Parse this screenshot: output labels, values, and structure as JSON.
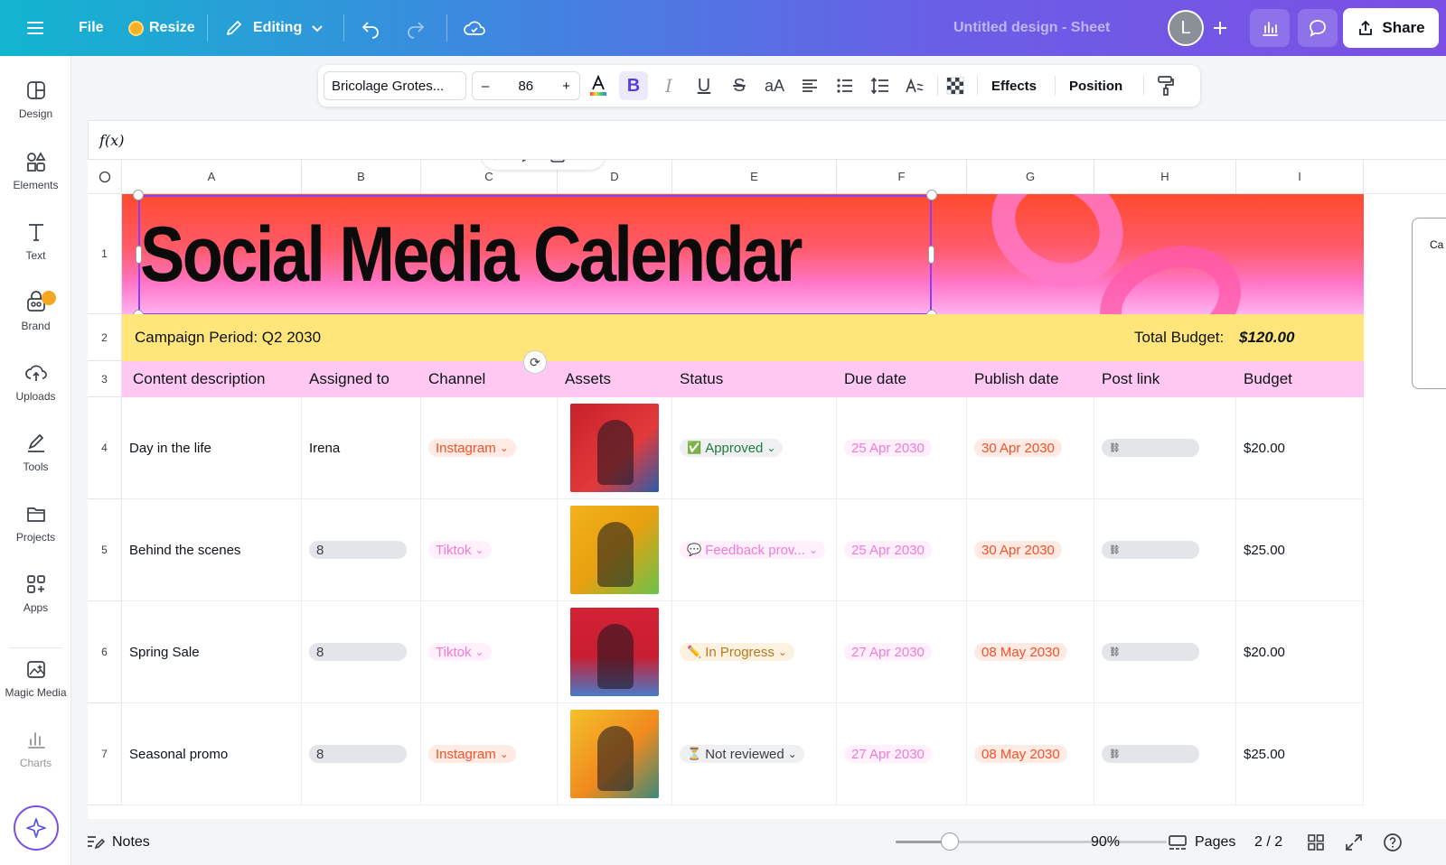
{
  "topbar": {
    "file": "File",
    "resize": "Resize",
    "editing": "Editing",
    "title": "Untitled design - Sheet",
    "avatar_initial": "L",
    "share": "Share"
  },
  "rail": {
    "items": [
      "Design",
      "Elements",
      "Text",
      "Brand",
      "Uploads",
      "Tools",
      "Projects",
      "Apps",
      "Magic Media",
      "Charts"
    ]
  },
  "format": {
    "font": "Bricolage Grotes...",
    "size": "86",
    "minus": "–",
    "plus": "+",
    "case": "aA",
    "effects": "Effects",
    "position": "Position"
  },
  "formula": {
    "label": "f(x)"
  },
  "sheet": {
    "columns": [
      "A",
      "B",
      "C",
      "D",
      "E",
      "F",
      "G",
      "H",
      "I"
    ],
    "rows": [
      "1",
      "2",
      "3",
      "4",
      "5",
      "6",
      "7"
    ],
    "title": "Social Media Calendar",
    "campaign": "Campaign Period: Q2 2030",
    "budget_label": "Total Budget:",
    "budget_value": "$120.00",
    "headers": [
      "Content description",
      "Assigned to",
      "Channel",
      "Assets",
      "Status",
      "Due date",
      "Publish date",
      "Post link",
      "Budget"
    ],
    "data": [
      {
        "desc": "Day in the life",
        "assigned": "Irena",
        "channel": "Instagram",
        "status": "Approved",
        "status_icon": "✅",
        "due": "25 Apr 2030",
        "publish": "30 Apr 2030",
        "budget": "$20.00"
      },
      {
        "desc": "Behind the scenes",
        "assigned": "8",
        "channel": "Tiktok",
        "status": "Feedback prov...",
        "status_icon": "💬",
        "due": "25 Apr 2030",
        "publish": "30 Apr 2030",
        "budget": "$25.00"
      },
      {
        "desc": "Spring Sale",
        "assigned": "8",
        "channel": "Tiktok",
        "status": "In Progress",
        "status_icon": "✏️",
        "due": "27 Apr 2030",
        "publish": "08 May 2030",
        "budget": "$20.00"
      },
      {
        "desc": "Seasonal promo",
        "assigned": "8",
        "channel": "Instagram",
        "status": "Not reviewed",
        "status_icon": "⏳",
        "due": "27 Apr 2030",
        "publish": "08 May 2030",
        "budget": "$25.00"
      }
    ],
    "side_panel_text": "Ca"
  },
  "bottom": {
    "notes": "Notes",
    "zoom": "90%",
    "zoom_fraction": 0.2,
    "pages": "Pages",
    "page_count": "2 / 2"
  },
  "colors": {
    "accent": "#8b3dff",
    "banner_top": "#ff4a2e",
    "banner_bottom": "#ffb3f0",
    "campaign_row": "#ffe57a",
    "header_row": "#ffc8f3"
  }
}
